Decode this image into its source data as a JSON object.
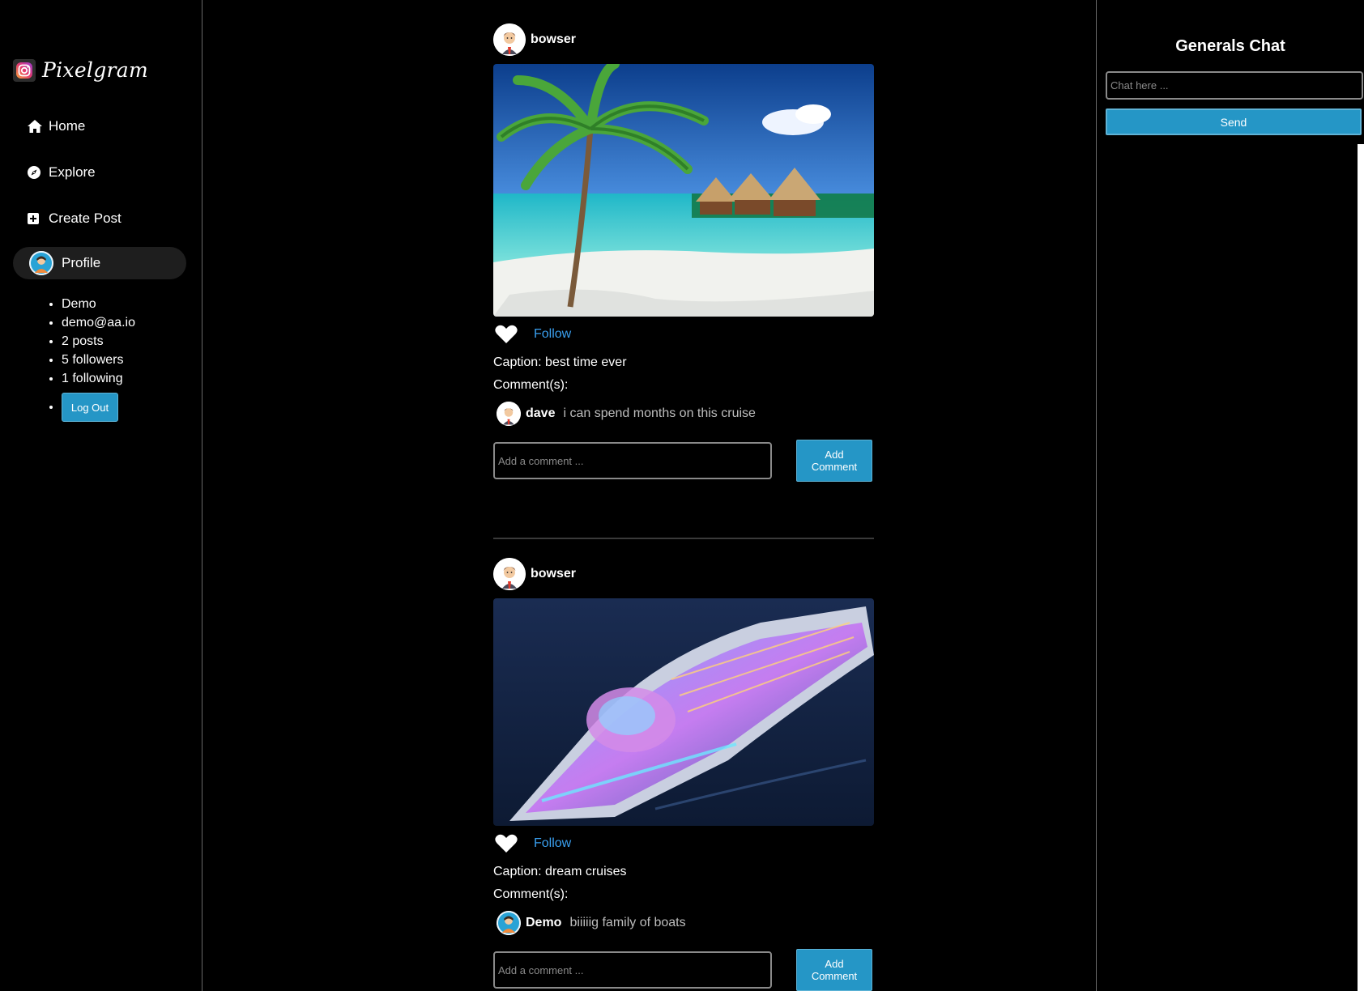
{
  "app": {
    "name": "Pixelgram",
    "logo_icon": "instagram-icon"
  },
  "nav": {
    "home": {
      "label": "Home",
      "icon": "home-icon"
    },
    "explore": {
      "label": "Explore",
      "icon": "compass-icon"
    },
    "create_post": {
      "label": "Create Post",
      "icon": "plus-square-icon"
    },
    "profile": {
      "label": "Profile",
      "icon": "avatar"
    }
  },
  "profile_info": {
    "name": "Demo",
    "email": "demo@aa.io",
    "posts": "2 posts",
    "followers": "5 followers",
    "following": "1 following",
    "logout_label": "Log Out"
  },
  "posts": [
    {
      "username": "bowser",
      "image_alt": "tropical beach with palm tree and overwater bungalows",
      "follow_label": "Follow",
      "caption": "Caption: best time ever",
      "comments_label": "Comment(s):",
      "comments": [
        {
          "user": "dave",
          "text": "i can spend months on this cruise"
        }
      ],
      "comment_placeholder": "Add a comment ...",
      "add_comment_label": "Add\nComment"
    },
    {
      "username": "bowser",
      "image_alt": "cruise ship at night on the ocean",
      "follow_label": "Follow",
      "caption": "Caption: dream cruises",
      "comments_label": "Comment(s):",
      "comments": [
        {
          "user": "Demo",
          "text": "biiiiig family of boats"
        }
      ],
      "comment_placeholder": "Add a comment ...",
      "add_comment_label": "Add\nComment"
    }
  ],
  "chat": {
    "title": "Generals Chat",
    "input_placeholder": "Chat here ...",
    "send_label": "Send"
  },
  "colors": {
    "accent": "#2596c6",
    "link": "#3aa0f0",
    "background": "#000000"
  }
}
